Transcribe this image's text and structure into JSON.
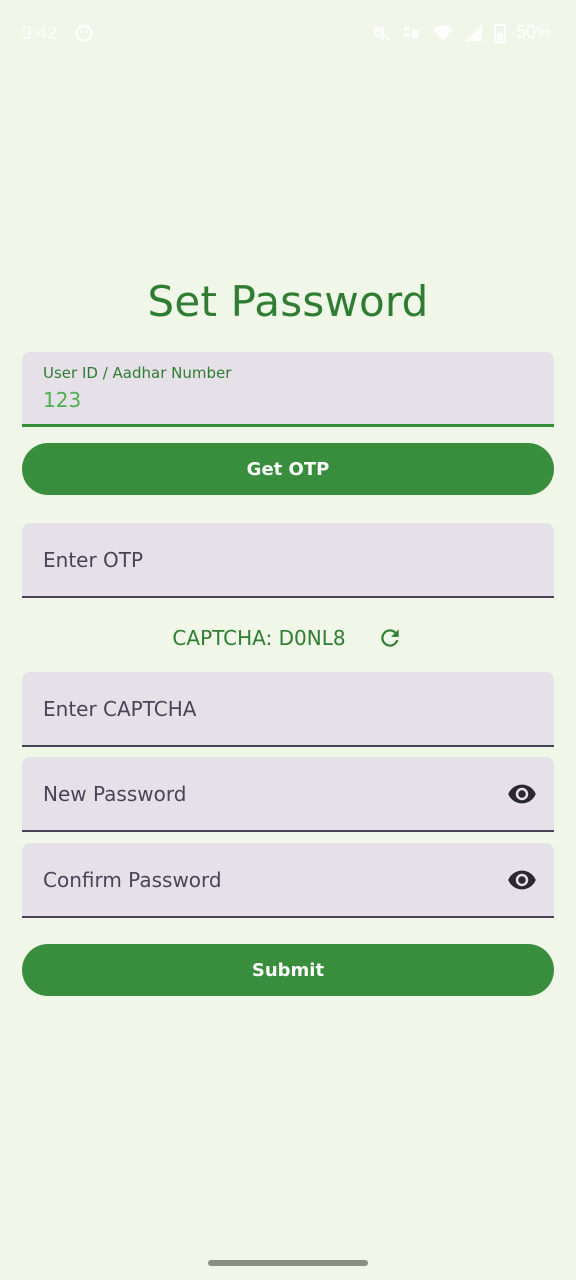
{
  "status_bar": {
    "time": "9:42",
    "battery": "50%"
  },
  "page": {
    "title": "Set Password"
  },
  "user_id_field": {
    "label": "User ID / Aadhar Number",
    "value": "123"
  },
  "get_otp_button": {
    "label": "Get OTP"
  },
  "otp_field": {
    "placeholder": "Enter OTP"
  },
  "captcha": {
    "text": "CAPTCHA: D0NL8"
  },
  "captcha_field": {
    "placeholder": "Enter CAPTCHA"
  },
  "new_password_field": {
    "placeholder": "New Password"
  },
  "confirm_password_field": {
    "placeholder": "Confirm Password"
  },
  "submit_button": {
    "label": "Submit"
  },
  "colors": {
    "background": "#f0f6e8",
    "primary": "#388e3c",
    "title": "#2e7d32",
    "field_bg": "#e6e0e8"
  },
  "icons": {
    "eye": "eye-icon",
    "refresh": "refresh-icon"
  }
}
